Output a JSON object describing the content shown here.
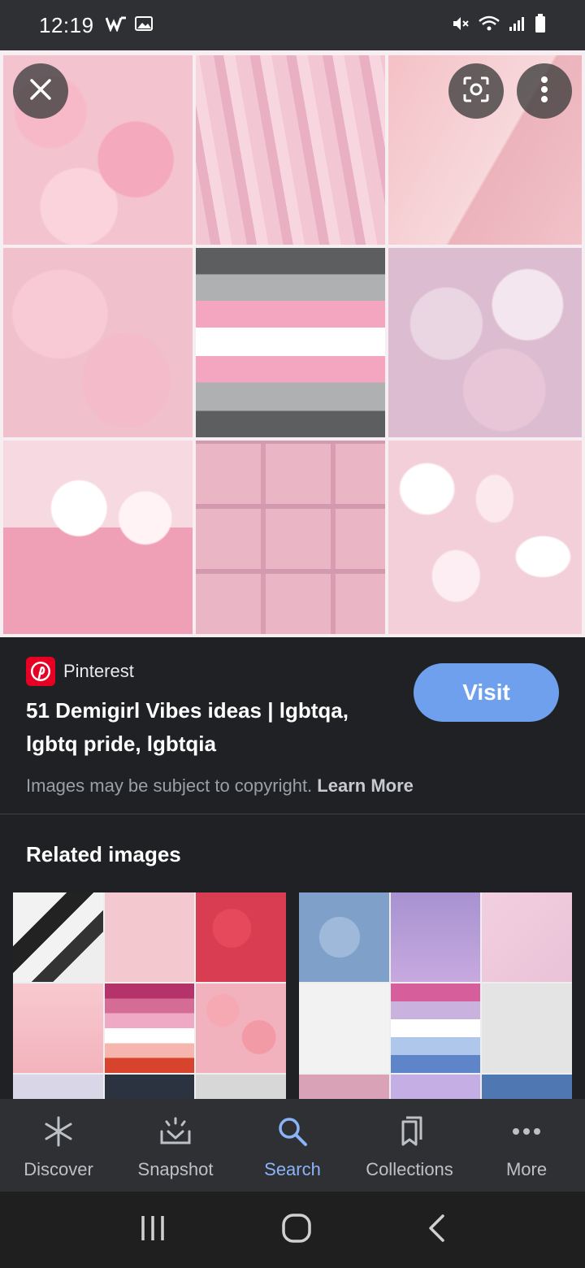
{
  "status_bar": {
    "time": "12:19"
  },
  "hero": {
    "close_icon": "close-icon",
    "lens_icon": "lens-icon",
    "more_icon": "more-vert-icon"
  },
  "result": {
    "source": "Pinterest",
    "title": "51 Demigirl Vibes ideas | lgbtqa, lgbtq pride, lgbtqia",
    "visit_label": "Visit",
    "copyright_text": "Images may be subject to copyright.",
    "learn_more": "Learn More"
  },
  "related": {
    "title": "Related images"
  },
  "bottom_nav": {
    "items": [
      {
        "label": "Discover",
        "icon": "asterisk-icon"
      },
      {
        "label": "Snapshot",
        "icon": "snapshot-icon"
      },
      {
        "label": "Search",
        "icon": "search-icon",
        "active": true
      },
      {
        "label": "Collections",
        "icon": "collections-icon"
      },
      {
        "label": "More",
        "icon": "more-horiz-icon"
      }
    ]
  },
  "colors": {
    "accent": "#8ab4f8",
    "visit_button": "#6ea0ee",
    "background": "#202124"
  }
}
